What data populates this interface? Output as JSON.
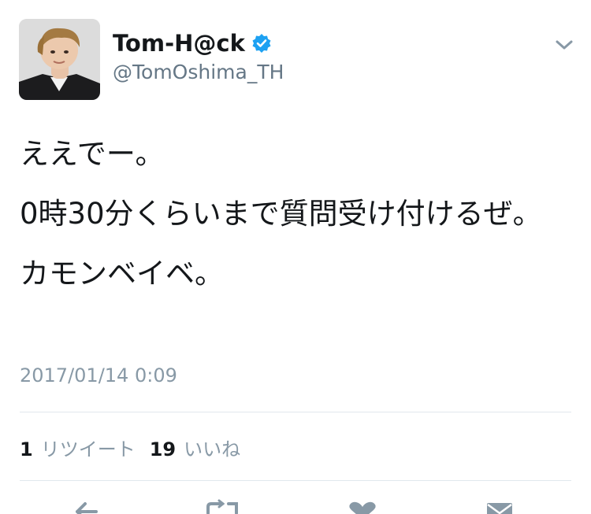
{
  "user": {
    "display_name": "Tom-H@ck",
    "handle": "@TomOshima_TH",
    "verified": true
  },
  "tweet": {
    "lines": [
      "ええでー。",
      "0時30分くらいまで質問受け付けるぜ。",
      "カモンベイベ。"
    ],
    "timestamp": "2017/01/14 0:09"
  },
  "stats": {
    "retweet_count": "1",
    "retweet_label": "リツイート",
    "like_count": "19",
    "like_label": "いいね"
  },
  "icons": {
    "verified": "verified-badge-icon",
    "menu": "chevron-down-icon",
    "reply": "reply-icon",
    "retweet": "retweet-icon",
    "like": "heart-icon",
    "message": "mail-icon"
  },
  "colors": {
    "verified": "#1da1f2",
    "secondary_text": "#657786",
    "muted_text": "#8899a6",
    "divider": "#e1e8ed",
    "action_icon": "#8899a6"
  }
}
